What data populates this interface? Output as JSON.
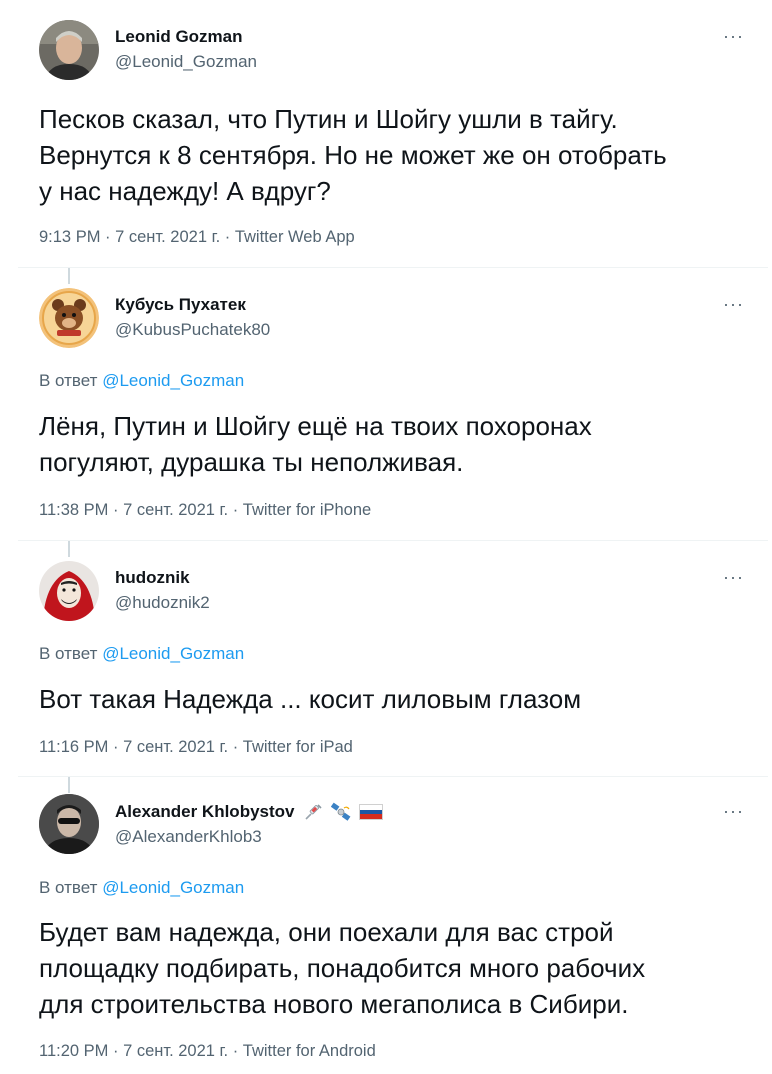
{
  "tweets": [
    {
      "name": "Leonid Gozman",
      "handle": "@Leonid_Gozman",
      "more": "···",
      "text": "Песков сказал, что Путин и Шойгу ушли в тайгу.\nВернутся к 8 сентября. Но не может же он отобрать\nу нас надежду! А вдруг?",
      "meta": "9:13 PM · 7 сент. 2021 г. · Twitter Web App"
    },
    {
      "name": "Кубусь Пухатек",
      "handle": "@KubusPuchatek80",
      "more": "···",
      "replying_prefix": "В ответ",
      "replying_mention": "@Leonid_Gozman",
      "text": "Лёня, Путин и Шойгу ещё на твоих похоронах\nпогуляют, дурашка ты неполживая.",
      "meta": "11:38 PM · 7 сент. 2021 г. · Twitter for iPhone"
    },
    {
      "name": "hudoznik",
      "handle": "@hudoznik2",
      "more": "···",
      "replying_prefix": "В ответ",
      "replying_mention": "@Leonid_Gozman",
      "text": "Вот такая Надежда ... косит лиловым глазом",
      "meta": "11:16 PM · 7 сент. 2021 г. · Twitter for iPad"
    },
    {
      "name": "Alexander Khlobystov",
      "handle": "@AlexanderKhlob3",
      "more": "···",
      "name_badges": [
        "syringe-icon",
        "satellite-icon",
        "russian-flag-icon"
      ],
      "replying_prefix": "В ответ",
      "replying_mention": "@Leonid_Gozman",
      "text": "Будет вам надежда, они поехали для вас строй\nплощадку подбирать, понадобится много рабочих\nдля строительства нового мегаполиса в Сибири.",
      "meta": "11:20 PM · 7 сент. 2021 г. · Twitter for Android"
    }
  ],
  "colors": {
    "text_primary": "#0f1419",
    "text_secondary": "#536471",
    "link": "#1d9bf0",
    "divider": "#eff3f4"
  }
}
